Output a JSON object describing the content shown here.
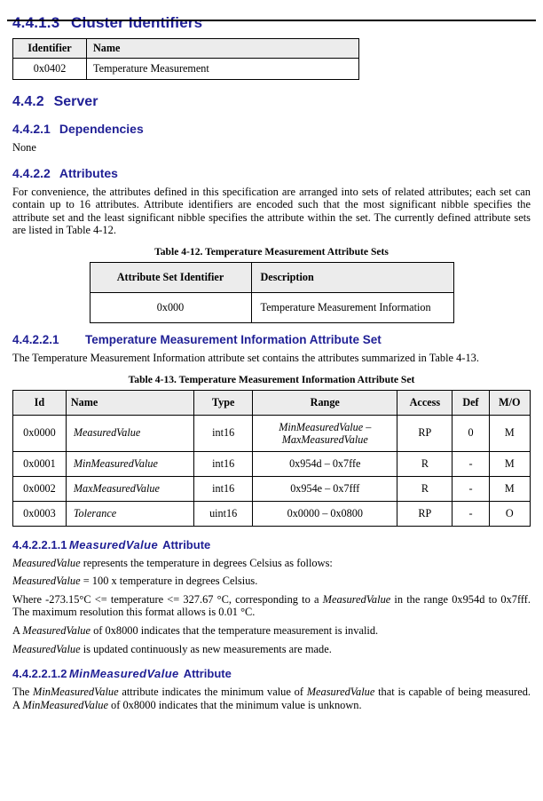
{
  "page_header": {
    "left": "",
    "right": ""
  },
  "sections": {
    "cluster_identifiers": {
      "num": "4.4.1.3",
      "title": "Cluster Identifiers"
    },
    "server": {
      "num": "4.4.2",
      "title": "Server"
    },
    "dependencies": {
      "num": "4.4.2.1",
      "title": "Dependencies",
      "body": "None"
    },
    "attributes": {
      "num": "4.4.2.2",
      "title": "Attributes",
      "body": "For convenience, the attributes defined in this specification are arranged into sets of related attributes; each set can contain up to 16 attributes. Attribute identifiers are encoded such that the most significant nibble specifies the attribute set and the least significant nibble specifies the attribute within the set. The currently defined attribute sets are listed in Table 4-12."
    },
    "info_attr_set": {
      "num": "4.4.2.2.1",
      "title": "Temperature Measurement Information Attribute Set",
      "body": "The Temperature Measurement Information attribute set contains the attributes summarized in Table 4-13."
    },
    "measured_value": {
      "num": "4.4.2.2.1.1",
      "title_italic": "MeasuredValue",
      "title_rest": "Attribute",
      "p1_italic": "MeasuredValue",
      "p1_rest": " represents the temperature in degrees Celsius as follows:",
      "p2_italic": "MeasuredValue",
      "p2_rest": " = 100 x temperature in degrees Celsius.",
      "p3_a": "Where -273.15°C <= temperature <= 327.67 °C, corresponding to a ",
      "p3_italic": "MeasuredValue",
      "p3_b": " in the range 0x954d to 0x7fff. The maximum resolution this format allows is 0.01 °C.",
      "p4_a": "A ",
      "p4_italic": "MeasuredValue",
      "p4_b": " of 0x8000 indicates that the temperature measurement is invalid.",
      "p5_italic": "MeasuredValue",
      "p5_rest": " is updated continuously as new measurements are made."
    },
    "min_measured_value": {
      "num": "4.4.2.2.1.2",
      "title_italic": "MinMeasuredValue",
      "title_rest": "Attribute",
      "p1_a": "The ",
      "p1_italic1": "MinMeasuredValue",
      "p1_b": " attribute indicates the minimum value of ",
      "p1_italic2": "MeasuredValue",
      "p1_c": " that is capable of being measured. A ",
      "p1_italic3": "MinMeasuredValue",
      "p1_d": " of 0x8000 indicates that the minimum value is unknown."
    }
  },
  "tables": {
    "cluster": {
      "headers": [
        "Identifier",
        "Name"
      ],
      "rows": [
        [
          "0x0402",
          "Temperature Measurement"
        ]
      ]
    },
    "attribute_sets": {
      "caption": "Table 4-12. Temperature Measurement Attribute Sets",
      "headers": [
        "Attribute Set Identifier",
        "Description"
      ],
      "rows": [
        [
          "0x000",
          "Temperature Measurement Information"
        ]
      ]
    },
    "attributes": {
      "caption": "Table 4-13. Temperature Measurement Information Attribute Set",
      "headers": [
        "Id",
        "Name",
        "Type",
        "Range",
        "Access",
        "Def",
        "M/O"
      ],
      "rows": [
        {
          "id": "0x0000",
          "name": "MeasuredValue",
          "type": "int16",
          "range_line1": "MinMeasuredValue –",
          "range_line2": "MaxMeasuredValue",
          "range_italic": true,
          "access": "RP",
          "def": "0",
          "mo": "M"
        },
        {
          "id": "0x0001",
          "name": "MinMeasuredValue",
          "type": "int16",
          "range_line1": "0x954d – 0x7ffe",
          "range_line2": "",
          "range_italic": false,
          "access": "R",
          "def": "-",
          "mo": "M"
        },
        {
          "id": "0x0002",
          "name": "MaxMeasuredValue",
          "type": "int16",
          "range_line1": "0x954e – 0x7fff",
          "range_line2": "",
          "range_italic": false,
          "access": "R",
          "def": "-",
          "mo": "M"
        },
        {
          "id": "0x0003",
          "name": "Tolerance",
          "type": "uint16",
          "range_line1": "0x0000 – 0x0800",
          "range_line2": "",
          "range_italic": false,
          "access": "RP",
          "def": "-",
          "mo": "O"
        }
      ]
    }
  },
  "colors": {
    "heading_blue": "#1f1f95",
    "table_header_fill": "#ececec",
    "border": "#000000",
    "text": "#000000"
  }
}
